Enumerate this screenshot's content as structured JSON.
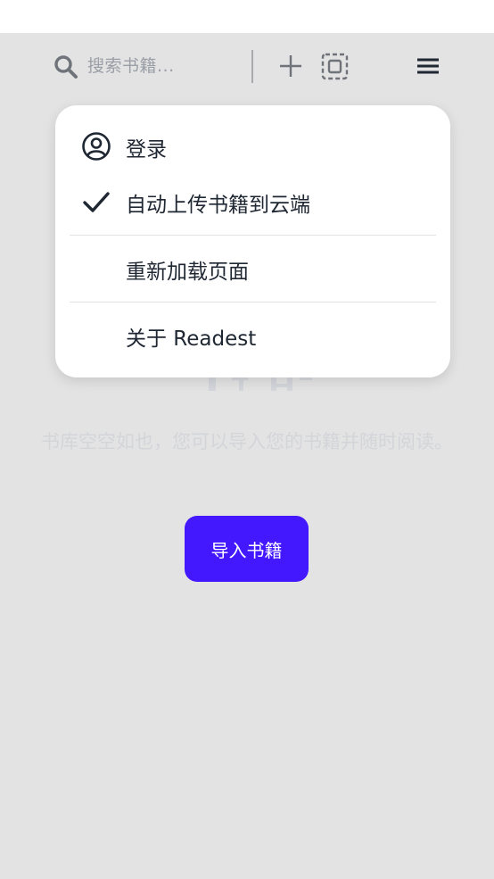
{
  "toolbar": {
    "search_placeholder": "搜索书籍..."
  },
  "library": {
    "empty_message": "书库空空如也，您可以导入您的书籍并随时阅读。",
    "import_button": "导入书籍"
  },
  "menu": {
    "items": [
      {
        "label": "登录",
        "icon": "user-circle-icon"
      },
      {
        "label": "自动上传书籍到云端",
        "icon": "check-icon",
        "checked": true
      },
      {
        "label": "重新加载页面"
      },
      {
        "label": "关于 Readest"
      }
    ]
  },
  "colors": {
    "accent": "#4318ff",
    "background": "#e3e3e3",
    "menu_bg": "#ffffff",
    "text_primary": "#1f2733"
  }
}
